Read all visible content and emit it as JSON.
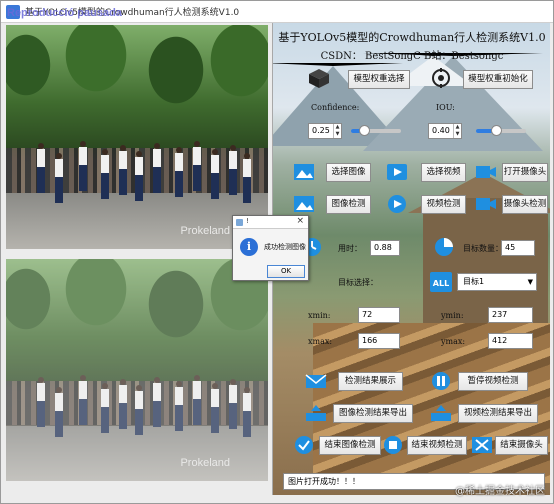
{
  "window": {
    "title": "基于YOLOv5模型的Crowdhuman行人检测系统V1.0",
    "watermark": "Reproducció pausada"
  },
  "panel": {
    "title": "基于YOLOv5模型的Crowdhuman行人检测系统V1.0",
    "subtitle": "CSDN：  BestSongC    B站：Bestsongc",
    "buttons": {
      "model_select": "模型权重选择",
      "model_init": "模型权重初始化",
      "select_image": "选择图像",
      "select_video": "选择视频",
      "open_camera": "打开摄像头",
      "image_detect": "图像检测",
      "video_detect": "视频检测",
      "camera_detect": "摄像头检测",
      "show_results": "检测结果展示",
      "pause_video": "暂停视频检测",
      "export_image": "图像检测结果导出",
      "export_video": "视频检测结果导出",
      "end_image": "结束图像检测",
      "end_video": "结束视频检测",
      "end_camera": "结束摄像头"
    },
    "confidence": {
      "label": "Confidence:",
      "value": "0.25",
      "slider": 0.25
    },
    "iou": {
      "label": "IOU:",
      "value": "0.40",
      "slider": 0.4
    },
    "time": {
      "label": "用时：",
      "value": "0.88"
    },
    "target_count": {
      "label": "目标数量：",
      "value": "45"
    },
    "target_select": {
      "label": "目标选择：",
      "value": "目标1"
    },
    "xmin": {
      "label": "xmin:",
      "value": "72"
    },
    "ymin": {
      "label": "ymin:",
      "value": "237"
    },
    "xmax": {
      "label": "xmax:",
      "value": "166"
    },
    "ymax": {
      "label": "ymax:",
      "value": "412"
    },
    "status": "图片打开成功！！！"
  },
  "dialog": {
    "title": "!",
    "close": "×",
    "message": "成功检测图像",
    "ok": "OK"
  },
  "video": {
    "logo": "Prokeland"
  },
  "overlay": {
    "csdn": "@稀土掘金技术社区"
  },
  "colors": {
    "accent": "#2f7de1",
    "info": "#2b6fd6"
  }
}
